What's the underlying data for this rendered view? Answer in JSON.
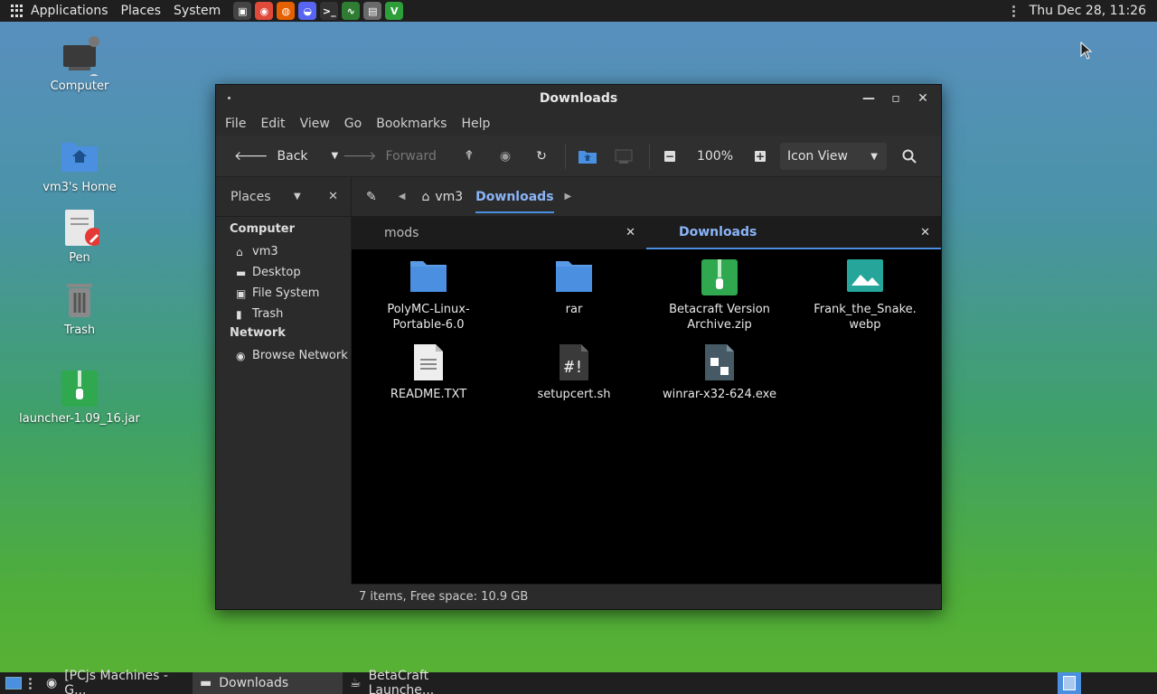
{
  "top_panel": {
    "menus": [
      "Applications",
      "Places",
      "System"
    ],
    "launchers": [
      {
        "icon": "screenshot-icon",
        "color": "#444444",
        "glyph": "▣"
      },
      {
        "icon": "chrome-icon",
        "color": "#e04a3a",
        "glyph": "◉"
      },
      {
        "icon": "firefox-icon",
        "color": "#e66000",
        "glyph": "◍"
      },
      {
        "icon": "discord-icon",
        "color": "#5865f2",
        "glyph": "◒"
      },
      {
        "icon": "terminal-icon",
        "color": "#333333",
        "glyph": ">_"
      },
      {
        "icon": "system-monitor-icon",
        "color": "#2e7d32",
        "glyph": "∿"
      },
      {
        "icon": "text-editor-icon",
        "color": "#6a6a6a",
        "glyph": "▤"
      },
      {
        "icon": "vim-icon",
        "color": "#2e9e3a",
        "glyph": "V"
      }
    ],
    "clock": "Thu Dec 28, 11:26"
  },
  "desktop": {
    "icons": [
      {
        "label": "Computer",
        "icon": "computer-icon"
      },
      {
        "label": "vm3's Home",
        "icon": "home-folder-icon"
      },
      {
        "label": "Pen",
        "icon": "pen-document-icon"
      },
      {
        "label": "Trash",
        "icon": "trash-icon"
      },
      {
        "label": "launcher-1.09_16.jar",
        "icon": "jar-archive-icon"
      }
    ]
  },
  "window": {
    "title": "Downloads",
    "menu": [
      "File",
      "Edit",
      "View",
      "Go",
      "Bookmarks",
      "Help"
    ],
    "toolbar": {
      "back_label": "Back",
      "forward_label": "Forward",
      "zoom": "100%",
      "view_mode": "Icon View"
    },
    "places_label": "Places",
    "path": {
      "home": "vm3",
      "current": "Downloads"
    },
    "sidebar": {
      "sections": [
        {
          "header": "Computer",
          "items": [
            {
              "label": "vm3",
              "icon": "home-icon"
            },
            {
              "label": "Desktop",
              "icon": "desktop-icon"
            },
            {
              "label": "File System",
              "icon": "drive-icon"
            },
            {
              "label": "Trash",
              "icon": "trash-icon"
            }
          ]
        },
        {
          "header": "Network",
          "items": [
            {
              "label": "Browse Network",
              "icon": "network-icon"
            }
          ]
        }
      ]
    },
    "tabs": [
      {
        "label": "mods",
        "active": false
      },
      {
        "label": "Downloads",
        "active": true
      }
    ],
    "files": [
      {
        "name": "PolyMC-Linux-\nPortable-6.0",
        "type": "folder"
      },
      {
        "name": "rar",
        "type": "folder"
      },
      {
        "name": "Betacraft Version\nArchive.zip",
        "type": "zip"
      },
      {
        "name": "Frank_the_Snake.\nwebp",
        "type": "image"
      },
      {
        "name": "README.TXT",
        "type": "text"
      },
      {
        "name": "setupcert.sh",
        "type": "script"
      },
      {
        "name": "winrar-x32-624.exe",
        "type": "exe"
      }
    ],
    "status": "7 items, Free space: 10.9 GB"
  },
  "taskbar": {
    "tasks": [
      {
        "label": "[PCjs Machines - G...",
        "icon": "chrome-icon",
        "active": false
      },
      {
        "label": "Downloads",
        "icon": "folder-icon",
        "active": true
      },
      {
        "label": "BetaCraft Launche...",
        "icon": "java-icon",
        "active": false
      }
    ]
  }
}
